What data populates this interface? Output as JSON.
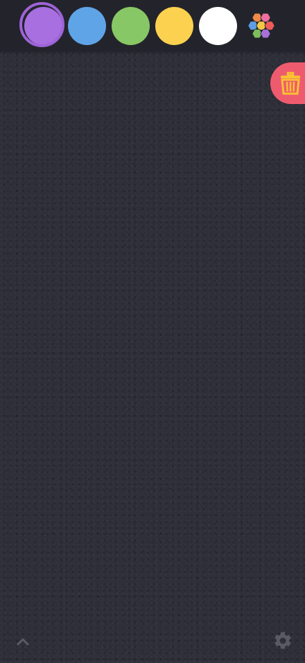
{
  "palette": {
    "swatches": [
      {
        "color": "#a76fe0",
        "ring": "#9d63d8",
        "selected": true
      },
      {
        "color": "#60a4e8",
        "selected": false
      },
      {
        "color": "#88c765",
        "selected": false
      },
      {
        "color": "#fcd14f",
        "selected": false
      },
      {
        "color": "#ffffff",
        "selected": false
      }
    ],
    "multicolor_icon": "hexagon-cluster-icon",
    "multicolor_colors": [
      "#f08a49",
      "#ee6fa0",
      "#5d9ee6",
      "#f5c842",
      "#ef5b5b",
      "#7cbf5a",
      "#a870d8"
    ]
  },
  "trash": {
    "icon": "trash-icon",
    "background": "#ef5b6e",
    "icon_color": "#f9c233"
  },
  "footer": {
    "expand_icon": "chevron-up-icon",
    "settings_icon": "gear-icon",
    "icon_color": "#585a66"
  }
}
